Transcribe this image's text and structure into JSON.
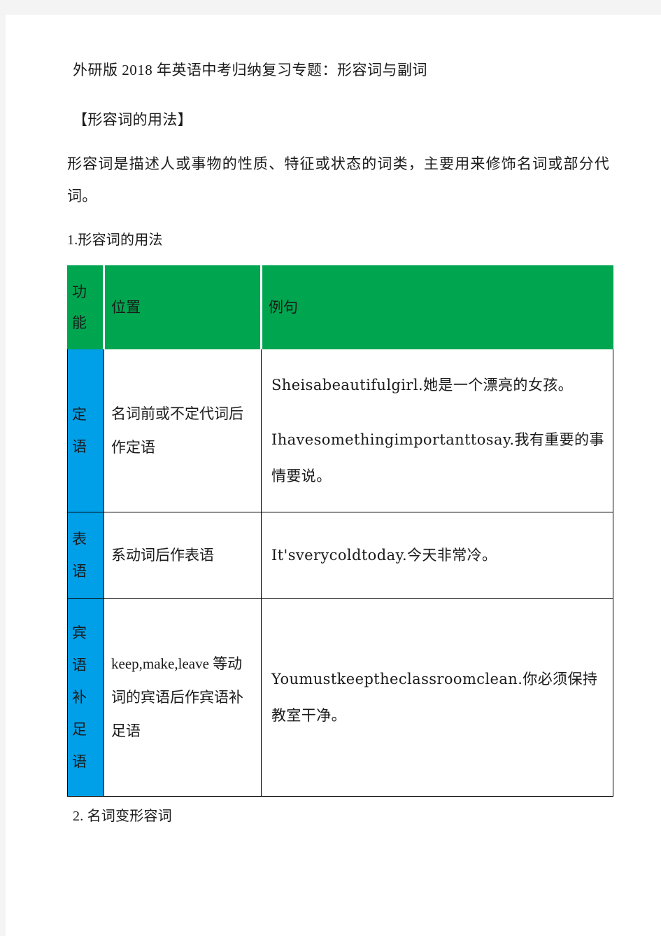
{
  "document": {
    "title": "外研版 2018 年英语中考归纳复习专题：形容词与副词",
    "section_heading": "【形容词的用法】",
    "intro_paragraph": "形容词是描述人或事物的性质、特征或状态的词类，主要用来修饰名词或部分代词。",
    "list_item_1": "1.形容词的用法",
    "list_item_2": "2. 名词变形容词"
  },
  "table": {
    "headers": {
      "function": "功能",
      "position": "位置",
      "example": "例句"
    },
    "rows": [
      {
        "function": "定语",
        "position": "名词前或不定代词后作定语",
        "examples": [
          "Sheisabeautifulgirl.她是一个漂亮的女孩。",
          "Ihavesomethingimportanttosay.我有重要的事情要说。"
        ]
      },
      {
        "function": "表语",
        "position": "系动词后作表语",
        "examples": [
          "It'sverycoldtoday.今天非常冷。"
        ]
      },
      {
        "function": "宾语补足语",
        "position": "keep,make,leave 等动词的宾语后作宾语补足语",
        "examples": [
          "Youmustkeeptheclassroomclean.你必须保持教室干净。"
        ]
      }
    ]
  },
  "colors": {
    "header_green": "#00a550",
    "function_blue": "#00a0e9",
    "page_background": "#ffffff",
    "canvas_background": "#f4f4f4",
    "text": "#1a1a1a",
    "border": "#000000"
  }
}
